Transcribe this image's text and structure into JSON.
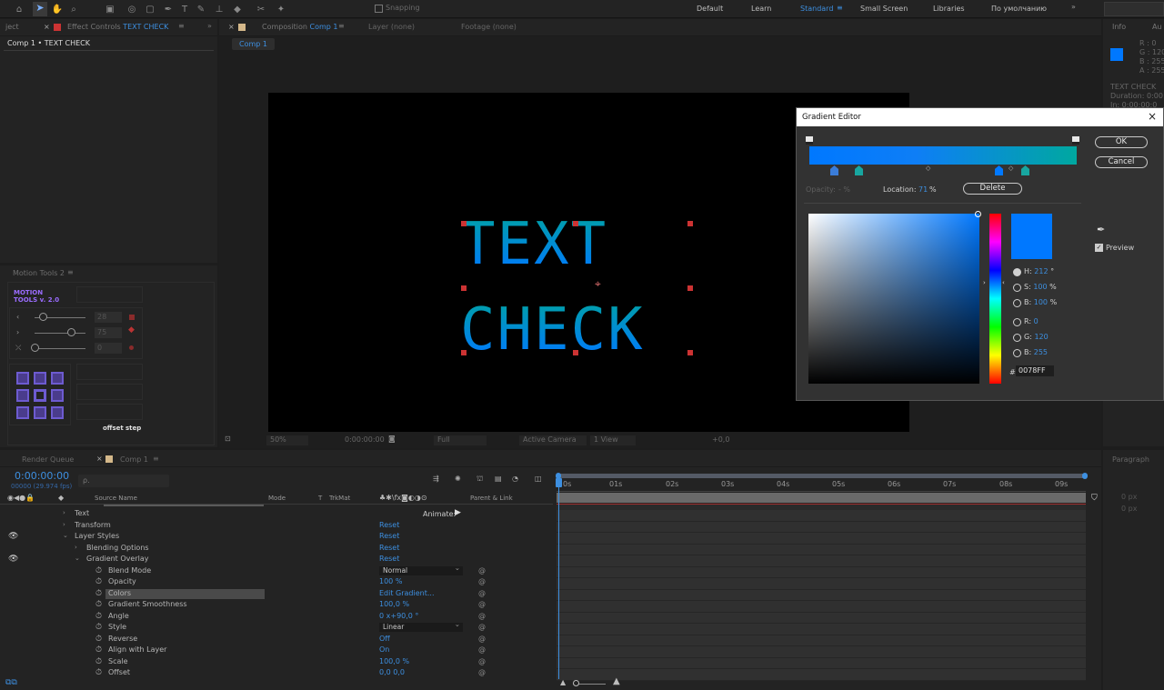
{
  "workspaces": [
    "Default",
    "Learn",
    "Standard",
    "Small Screen",
    "Libraries",
    "По умолчанию"
  ],
  "toolbar": {
    "snapping_label": "Snapping"
  },
  "left_panel": {
    "tab_project": "ject",
    "tab_effect_controls": "Effect Controls",
    "effect_controls_layer": "TEXT CHECK",
    "breadcrumb": "Comp 1 • TEXT CHECK"
  },
  "motion_tools": {
    "panel_title": "Motion Tools 2",
    "logo_line1": "MOTION",
    "logo_line2": "TOOLS v. 2.0",
    "val1": "28",
    "val2": "75",
    "val3": "0",
    "offset_label": "offset",
    "step_label": "step"
  },
  "composition": {
    "tab_label": "Composition",
    "comp_name": "Comp 1",
    "layer_tab": "Layer (none)",
    "footage_tab": "Footage (none)",
    "subtab": "Comp 1",
    "canvas_text_line1": "TEXT",
    "canvas_text_line2": "CHECK"
  },
  "viewer_bar": {
    "zoom": "50%",
    "timecode": "0:00:00:00",
    "resolution": "Full",
    "camera": "Active Camera",
    "views": "1 View",
    "exposure": "+0,0"
  },
  "info_panel": {
    "tab": "Info",
    "tab2": "Au",
    "r": "R : 0",
    "g": "G : 120",
    "b": "B : 255",
    "a": "A : 255",
    "layer_name": "TEXT CHECK",
    "duration": "Duration: 0:00:0",
    "in_point": "In: 0:00:00:0",
    "color": "#0078FF"
  },
  "gradient_editor": {
    "title": "Gradient Editor",
    "ok_label": "OK",
    "cancel_label": "Cancel",
    "opacity_label": "Opacity:",
    "opacity_value": "- %",
    "location_label": "Location:",
    "location_value": "71",
    "location_unit": "%",
    "delete_label": "Delete",
    "preview_label": "Preview",
    "h_label": "H:",
    "h_value": "212",
    "h_unit": "°",
    "s_label": "S:",
    "s_value": "100",
    "s_unit": "%",
    "b_label": "B:",
    "b_value": "100",
    "b_unit": "%",
    "r_label": "R:",
    "r_value": "0",
    "g_label": "G:",
    "g_value": "120",
    "bl_label": "B:",
    "bl_value": "255",
    "hex_prefix": "#",
    "hex_value": "0078FF",
    "current_color": "#0078FF",
    "gradient_start": "#0078FF",
    "gradient_end": "#00A8A0"
  },
  "timeline": {
    "tab_render_queue": "Render Queue",
    "tab_comp": "Comp 1",
    "timecode": "0:00:00:00",
    "frames": "00000 (29.974 fps)",
    "search_placeholder": "ρ.",
    "col_source_name": "Source Name",
    "col_mode": "Mode",
    "col_t": "T",
    "col_trkmat": "TrkMat",
    "col_parent": "Parent & Link",
    "animate_label": "Animate:",
    "ruler": [
      "0s",
      "01s",
      "02s",
      "03s",
      "04s",
      "05s",
      "06s",
      "07s",
      "08s",
      "09s"
    ],
    "rows": [
      {
        "name": "Text",
        "value": "",
        "indent": 1,
        "twirl": "›",
        "eye": false
      },
      {
        "name": "Transform",
        "value": "Reset",
        "indent": 1,
        "twirl": "›",
        "eye": false
      },
      {
        "name": "Layer Styles",
        "value": "Reset",
        "indent": 1,
        "twirl": "⌄",
        "eye": true
      },
      {
        "name": "Blending Options",
        "value": "Reset",
        "indent": 2,
        "twirl": "›",
        "eye": false
      },
      {
        "name": "Gradient Overlay",
        "value": "Reset",
        "indent": 2,
        "twirl": "⌄",
        "eye": true
      },
      {
        "name": "Blend Mode",
        "value": "Normal",
        "indent": 3,
        "dropdown": true
      },
      {
        "name": "Opacity",
        "value": "100 %",
        "indent": 3
      },
      {
        "name": "Colors",
        "value": "Edit Gradient...",
        "indent": 3,
        "selected": true
      },
      {
        "name": "Gradient Smoothness",
        "value": "100,0 %",
        "indent": 3
      },
      {
        "name": "Angle",
        "value": "0 x+90,0 °",
        "indent": 3
      },
      {
        "name": "Style",
        "value": "Linear",
        "indent": 3,
        "dropdown": true
      },
      {
        "name": "Reverse",
        "value": "Off",
        "indent": 3
      },
      {
        "name": "Align with Layer",
        "value": "On",
        "indent": 3
      },
      {
        "name": "Scale",
        "value": "100,0 %",
        "indent": 3
      },
      {
        "name": "Offset",
        "value": "0,0 0,0",
        "indent": 3
      }
    ]
  },
  "paragraph_panel": {
    "tab": "Paragraph",
    "v1": "0 px",
    "v2": "0 px"
  }
}
